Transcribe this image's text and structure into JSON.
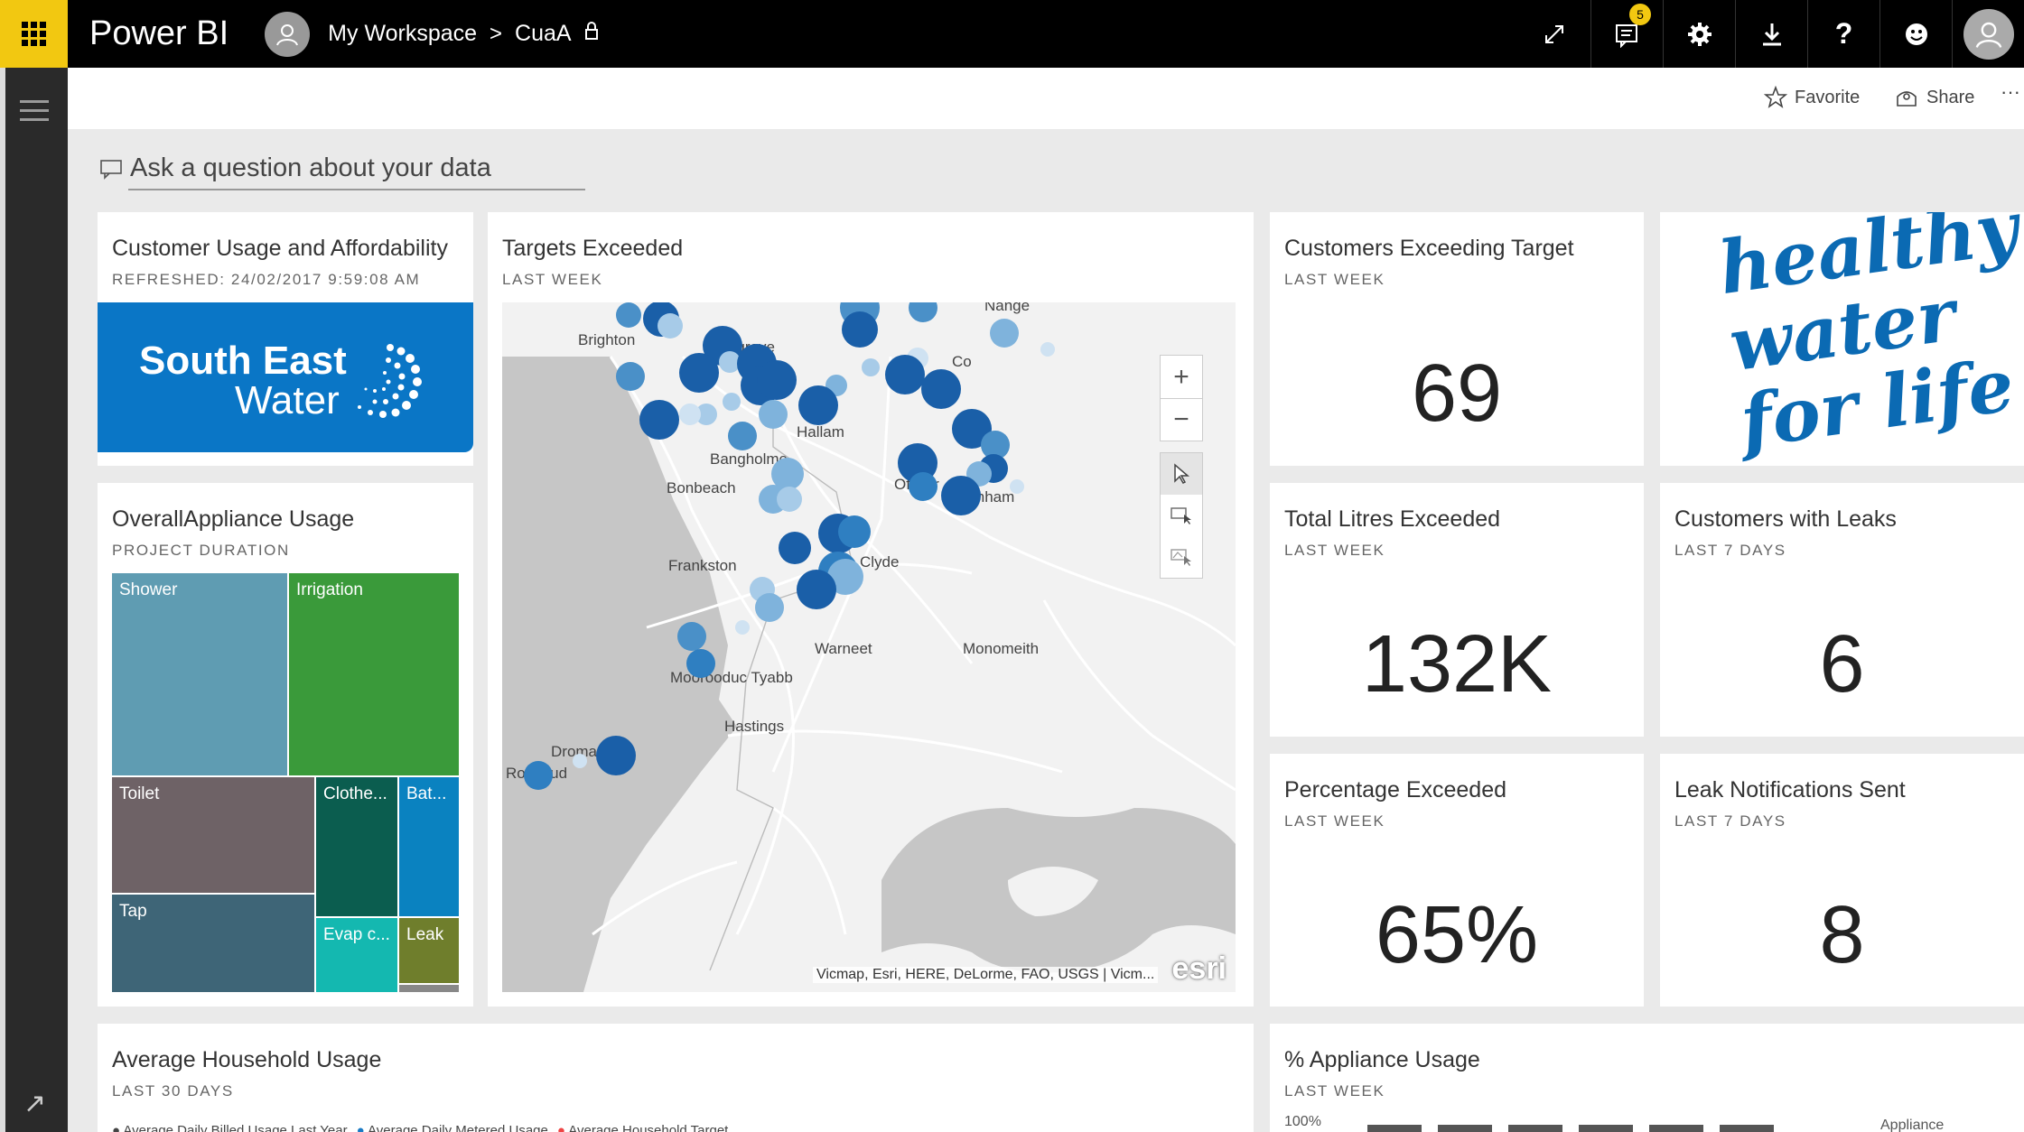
{
  "app": {
    "brand": "Power BI"
  },
  "breadcrumb": {
    "workspace": "My Workspace",
    "separator": ">",
    "dashboard": "CuaA"
  },
  "topbar": {
    "notifications_count": "5"
  },
  "actions": {
    "favorite": "Favorite",
    "share": "Share",
    "more": "···"
  },
  "qna": {
    "placeholder": "Ask a question about your data"
  },
  "tiles": {
    "customer_usage": {
      "title": "Customer Usage and Affordability",
      "subtitle": "REFRESHED: 24/02/2017 9:59:08 AM",
      "logo_line1": "South East",
      "logo_line2": "Water"
    },
    "targets_exceeded": {
      "title": "Targets Exceeded",
      "subtitle": "LAST WEEK"
    },
    "customers_exceeding": {
      "title": "Customers Exceeding Target",
      "subtitle": "LAST WEEK",
      "value": "69"
    },
    "healthy_water": {
      "line1": "healthy",
      "line2": "water",
      "line3": "for life"
    },
    "overall_appliance": {
      "title": "OverallAppliance Usage",
      "subtitle": "PROJECT DURATION"
    },
    "total_litres": {
      "title": "Total Litres Exceeded",
      "subtitle": "LAST WEEK",
      "value": "132K"
    },
    "customers_leaks": {
      "title": "Customers with Leaks",
      "subtitle": "LAST 7 DAYS",
      "value": "6"
    },
    "percentage_exceeded": {
      "title": "Percentage Exceeded",
      "subtitle": "LAST WEEK",
      "value": "65%"
    },
    "leak_notifications": {
      "title": "Leak Notifications Sent",
      "subtitle": "LAST 7 DAYS",
      "value": "8"
    },
    "avg_household": {
      "title": "Average Household Usage",
      "subtitle": "LAST 30 DAYS"
    },
    "pct_appliance": {
      "title": "% Appliance Usage",
      "subtitle": "LAST WEEK",
      "axis_top": "100%",
      "legend_label": "Appliance"
    }
  },
  "treemap": [
    {
      "label": "Shower",
      "color": "#5f9cb2"
    },
    {
      "label": "Irrigation",
      "color": "#3a9a3a"
    },
    {
      "label": "Toilet",
      "color": "#6e6266"
    },
    {
      "label": "Clothe...",
      "color": "#0b5d4f"
    },
    {
      "label": "Bat...",
      "color": "#0a82c0"
    },
    {
      "label": "Tap",
      "color": "#3e6577"
    },
    {
      "label": "Evap c...",
      "color": "#14b8b0"
    },
    {
      "label": "Leak",
      "color": "#6f7e2c"
    }
  ],
  "map": {
    "places": [
      "Brighton",
      "Mulgrave",
      "Bangholme",
      "Bonbeach",
      "Officer",
      "Pakenham",
      "Frankston",
      "Clyde",
      "Warneet",
      "Monomeith",
      "Moorooduc Tyabb",
      "Hastings",
      "Dromana",
      "Rosebud",
      "Hallam",
      "Nange",
      "Co"
    ],
    "attribution": "Vicmap, Esri, HERE, DeLorme, FAO, USGS | Vicm...",
    "esri": "esri"
  },
  "avg_legend": [
    "Average Daily Billed Usage Last Year",
    "Average Daily Metered Usage",
    "Average Household Target"
  ]
}
